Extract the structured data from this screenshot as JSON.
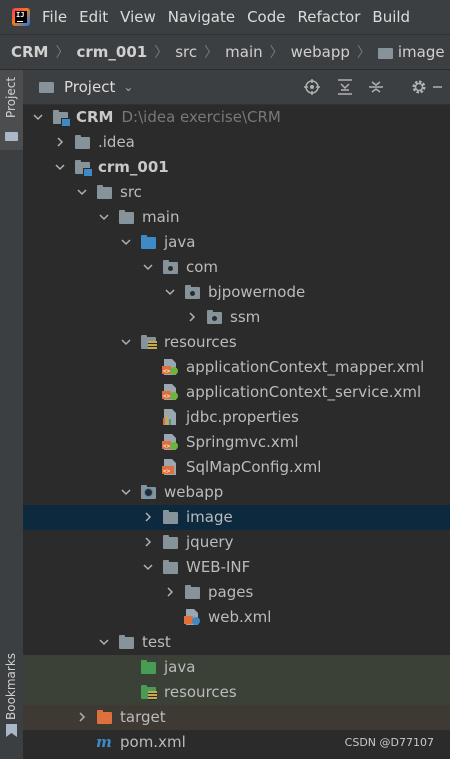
{
  "menubar": {
    "items": [
      "File",
      "Edit",
      "View",
      "Navigate",
      "Code",
      "Refactor",
      "Build"
    ]
  },
  "breadcrumb": {
    "items": [
      "CRM",
      "crm_001",
      "src",
      "main",
      "webapp",
      "image"
    ]
  },
  "left_strip": {
    "project_tab": "Project",
    "bookmarks_tab": "Bookmarks"
  },
  "panel": {
    "title": "Project"
  },
  "tree": {
    "rows": [
      {
        "label": "CRM",
        "hint": "D:\\idea exercise\\CRM",
        "bold": true,
        "icon": "module-folder-icon",
        "arrow": "down",
        "level": 0
      },
      {
        "label": ".idea",
        "arrow": "right",
        "icon": "folder-icon",
        "level": 1
      },
      {
        "label": "crm_001",
        "bold": true,
        "arrow": "down",
        "icon": "module-folder-icon",
        "level": 1
      },
      {
        "label": "src",
        "arrow": "down",
        "icon": "folder-icon",
        "level": 2
      },
      {
        "label": "main",
        "arrow": "down",
        "icon": "folder-icon",
        "level": 3
      },
      {
        "label": "java",
        "arrow": "down",
        "icon": "source-folder-icon",
        "level": 4
      },
      {
        "label": "com",
        "arrow": "down",
        "icon": "package-icon",
        "level": 5
      },
      {
        "label": "bjpowernode",
        "arrow": "down",
        "icon": "package-icon",
        "level": 6
      },
      {
        "label": "ssm",
        "arrow": "right",
        "icon": "package-icon",
        "level": 7
      },
      {
        "label": "resources",
        "arrow": "down",
        "icon": "resources-folder-icon",
        "level": 4
      },
      {
        "label": "applicationContext_mapper.xml",
        "icon": "spring-xml-icon",
        "level": 5
      },
      {
        "label": "applicationContext_service.xml",
        "icon": "spring-xml-icon",
        "level": 5
      },
      {
        "label": "jdbc.properties",
        "icon": "properties-file-icon",
        "level": 5
      },
      {
        "label": "Springmvc.xml",
        "icon": "spring-xml-icon",
        "level": 5
      },
      {
        "label": "SqlMapConfig.xml",
        "icon": "xml-file-icon",
        "level": 5
      },
      {
        "label": "webapp",
        "arrow": "down",
        "icon": "web-folder-icon",
        "level": 4
      },
      {
        "label": "image",
        "arrow": "right",
        "icon": "folder-icon",
        "level": 5,
        "selected": true
      },
      {
        "label": "jquery",
        "arrow": "right",
        "icon": "folder-icon",
        "level": 5
      },
      {
        "label": "WEB-INF",
        "arrow": "down",
        "icon": "folder-icon",
        "level": 5
      },
      {
        "label": "pages",
        "arrow": "right",
        "icon": "folder-icon",
        "level": 6
      },
      {
        "label": "web.xml",
        "icon": "web-xml-icon",
        "level": 6
      },
      {
        "label": "test",
        "arrow": "down",
        "icon": "folder-icon",
        "level": 3
      },
      {
        "label": "java",
        "icon": "test-folder-icon",
        "level": 4,
        "bg": "test"
      },
      {
        "label": "resources",
        "icon": "test-resources-folder-icon",
        "level": 4,
        "bg": "test"
      },
      {
        "label": "target",
        "arrow": "right",
        "icon": "excluded-folder-icon",
        "level": 2,
        "bg": "excluded"
      },
      {
        "label": "pom.xml",
        "icon": "maven-icon",
        "level": 2
      }
    ]
  },
  "watermark": "CSDN @D77107",
  "colors": {
    "background": "#2b2b2b",
    "toolbar": "#3c3f41",
    "selection": "#0d293e",
    "test_row": "#3b4137",
    "excluded_row": "#3e3a33",
    "folder_gray": "#87939a",
    "source_blue": "#3d8ac7",
    "test_green": "#499c54",
    "excluded_orange": "#e0703b"
  }
}
